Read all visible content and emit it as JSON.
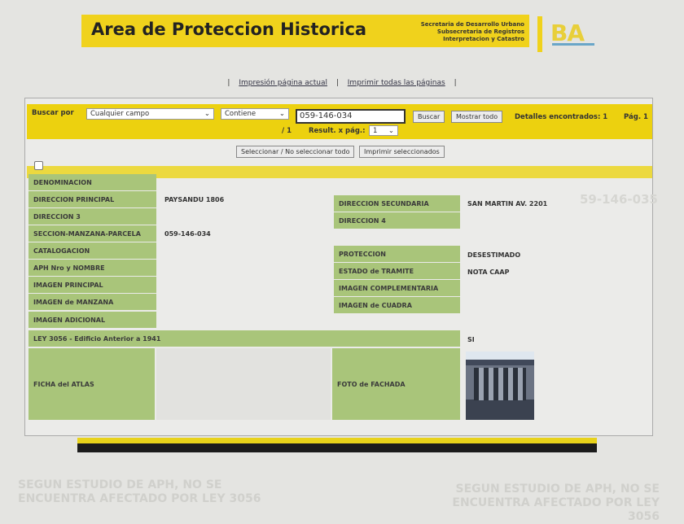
{
  "header": {
    "title": "Area de Proteccion Historica",
    "secretaria": [
      "Secretaria de Desarrollo Urbano",
      "Subsecretaria de Registros",
      "Interpretacion y Catastro"
    ],
    "logo": "BA"
  },
  "links": {
    "print_current": "Impresión página actual",
    "print_all": "Imprimir todas las páginas",
    "sep": "|"
  },
  "search": {
    "label": "Buscar por",
    "field": "Cualquier campo",
    "operator": "Contiene",
    "value": "059-146-034",
    "buscar": "Buscar",
    "mostrar_todo": "Mostrar todo",
    "details": "Detalles encontrados: 1",
    "page": "Pág. 1",
    "page_total": "/ 1",
    "per_page_label": "Result. x pág.:",
    "per_page": "1"
  },
  "actions": {
    "select_all": "Seleccionar / No seleccionar todo",
    "print_selected": "Imprimir seleccionados"
  },
  "fields": {
    "denominacion": {
      "label": "DENOMINACION",
      "value": ""
    },
    "dir_principal": {
      "label": "DIRECCION PRINCIPAL",
      "value": "PAYSANDU 1806"
    },
    "dir_secundaria": {
      "label": "DIRECCION SECUNDARIA",
      "value": "SAN MARTIN AV. 2201"
    },
    "dir3": {
      "label": "DIRECCION 3",
      "value": ""
    },
    "dir4": {
      "label": "DIRECCION 4",
      "value": ""
    },
    "smp": {
      "label": "SECCION-MANZANA-PARCELA",
      "value": "059-146-034"
    },
    "catalogacion": {
      "label": "CATALOGACION",
      "value": ""
    },
    "proteccion": {
      "label": "PROTECCION",
      "value": "DESESTIMADO"
    },
    "aph": {
      "label": "APH Nro y NOMBRE",
      "value": ""
    },
    "estado": {
      "label": "ESTADO de TRAMITE",
      "value": "NOTA CAAP"
    },
    "img_principal": {
      "label": "IMAGEN PRINCIPAL"
    },
    "img_complementaria": {
      "label": "IMAGEN COMPLEMENTARIA"
    },
    "img_manzana": {
      "label": "IMAGEN de MANZANA"
    },
    "img_cuadra": {
      "label": "IMAGEN de CUADRA"
    },
    "img_adicional": {
      "label": "IMAGEN ADICIONAL"
    },
    "ley": {
      "label": "LEY 3056 - Edificio Anterior a 1941",
      "value": "SI"
    },
    "ficha": {
      "label": "FICHA del ATLAS"
    },
    "foto": {
      "label": "FOTO de FACHADA"
    }
  },
  "ghost": {
    "left": "SEGUN ESTUDIO DE APH, NO SE ENCUENTRA AFECTADO POR LEY 3056",
    "right": "SEGUN ESTUDIO DE APH, NO SE ENCUENTRA AFECTADO POR LEY 3056",
    "code": "59-146-035"
  }
}
